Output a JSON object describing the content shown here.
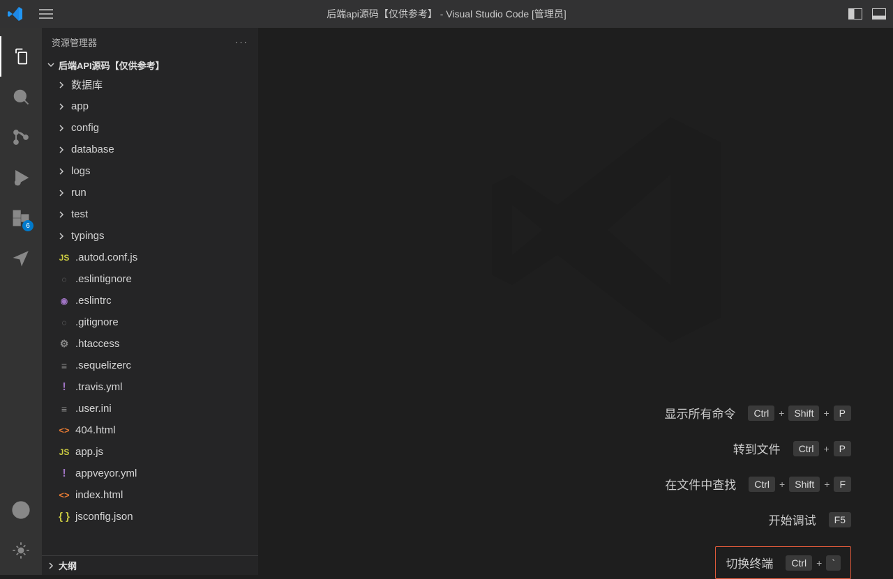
{
  "titlebar": {
    "title": "后端api源码【仅供参考】 - Visual Studio Code [管理员]"
  },
  "activitybar": {
    "extensions_badge": "6"
  },
  "sidebar": {
    "header": "资源管理器",
    "more": "···",
    "workspace": "后端API源码【仅供参考】",
    "folders": [
      {
        "label": "数据库"
      },
      {
        "label": "app"
      },
      {
        "label": "config"
      },
      {
        "label": "database"
      },
      {
        "label": "logs"
      },
      {
        "label": "run"
      },
      {
        "label": "test"
      },
      {
        "label": "typings"
      }
    ],
    "files": [
      {
        "icon": "js",
        "label": ".autod.conf.js"
      },
      {
        "icon": "ign",
        "label": ".eslintignore"
      },
      {
        "icon": "circ",
        "label": ".eslintrc"
      },
      {
        "icon": "ign",
        "label": ".gitignore"
      },
      {
        "icon": "gear",
        "label": ".htaccess"
      },
      {
        "icon": "list",
        "label": ".sequelizerc"
      },
      {
        "icon": "bang",
        "label": ".travis.yml"
      },
      {
        "icon": "list",
        "label": ".user.ini"
      },
      {
        "icon": "html",
        "label": "404.html"
      },
      {
        "icon": "js",
        "label": "app.js"
      },
      {
        "icon": "bang",
        "label": "appveyor.yml"
      },
      {
        "icon": "html",
        "label": "index.html"
      },
      {
        "icon": "brace",
        "label": "jsconfig.json"
      }
    ],
    "outline": "大纲"
  },
  "hints": {
    "rows": [
      {
        "label": "显示所有命令",
        "keys": [
          "Ctrl",
          "Shift",
          "P"
        ],
        "highlight": false
      },
      {
        "label": "转到文件",
        "keys": [
          "Ctrl",
          "P"
        ],
        "highlight": false
      },
      {
        "label": "在文件中查找",
        "keys": [
          "Ctrl",
          "Shift",
          "F"
        ],
        "highlight": false
      },
      {
        "label": "开始调试",
        "keys": [
          "F5"
        ],
        "highlight": false
      },
      {
        "label": "切换终端",
        "keys": [
          "Ctrl",
          "`"
        ],
        "highlight": true
      }
    ]
  }
}
